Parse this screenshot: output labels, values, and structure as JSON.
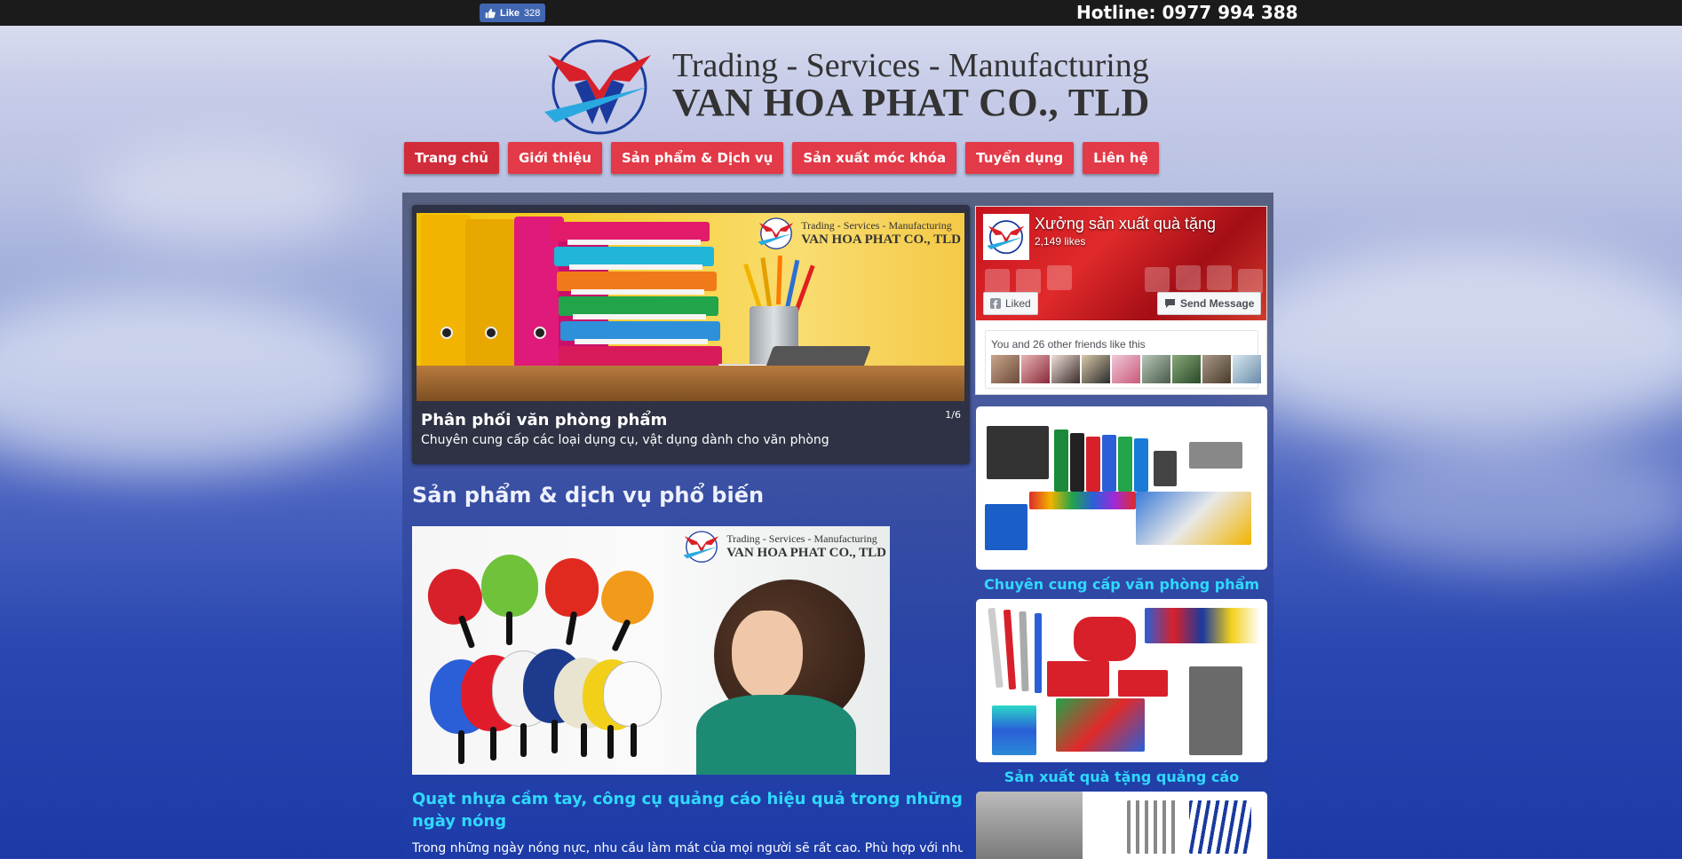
{
  "topbar": {
    "fb_like_label": "Like",
    "fb_like_count": "328",
    "hotline": "Hotline: 0977 994 388"
  },
  "logo": {
    "line1": "Trading - Services - Manufacturing",
    "line2": "VAN HOA PHAT CO., TLD"
  },
  "nav": {
    "items": [
      {
        "label": "Trang chủ"
      },
      {
        "label": "Giới thiệu"
      },
      {
        "label": "Sản phẩm & Dịch vụ"
      },
      {
        "label": "Sản xuất móc khóa"
      },
      {
        "label": "Tuyển dụng"
      },
      {
        "label": "Liên hệ"
      }
    ]
  },
  "slider": {
    "title": "Phân phối văn phòng phẩm",
    "subtitle": "Chuyên cung cấp các loại dụng cụ, vật dụng dành cho văn phòng",
    "counter": "1/6",
    "logo_line1": "Trading - Services - Manufacturing",
    "logo_line2": "VAN HOA PHAT CO., TLD"
  },
  "main": {
    "section_heading": "Sản phẩm & dịch vụ phổ biến",
    "feature_logo_line1": "Trading - Services - Manufacturing",
    "feature_logo_line2": "VAN HOA PHAT CO., TLD",
    "feature_title": "Quạt nhựa cầm tay, công cụ quảng cáo hiệu quả trong những ngày nóng",
    "feature_text": "Trong những ngày nóng nực, nhu cầu làm mát của mọi người sẽ rất cao. Phù hợp với nhu cầu"
  },
  "facebook_page": {
    "name": "Xưởng sản xuất quà tặng",
    "likes": "2,149 likes",
    "liked_button": "Liked",
    "message_button": "Send Message",
    "friends_text": "You and 26 other friends like this"
  },
  "sidebar": {
    "cards": [
      {
        "caption": "Chuyên cung cấp văn phòng phẩm"
      },
      {
        "caption": "Sản xuất quà tặng quảng cáo"
      }
    ]
  },
  "colors": {
    "nav_red": "#e23a48",
    "caption_cyan": "#2fd9ff",
    "fb_blue": "#4267b2"
  }
}
